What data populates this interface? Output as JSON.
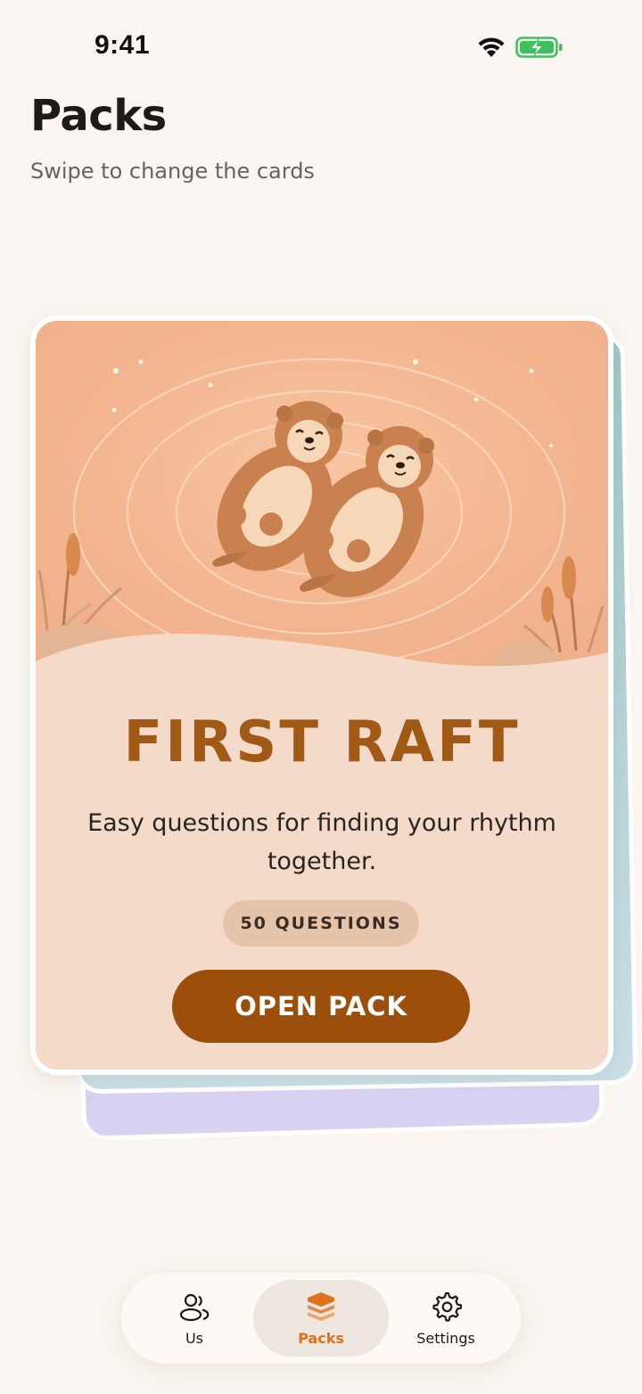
{
  "status_bar": {
    "time": "9:41",
    "wifi_icon": "wifi-icon",
    "battery_icon": "battery-charging-icon",
    "battery_color": "#3cc15e"
  },
  "header": {
    "title": "Packs",
    "subtitle": "Swipe to change the cards"
  },
  "pack_card": {
    "title": "FIRST RAFT",
    "description": "Easy questions for finding your rhythm together.",
    "badge": "50 QUESTIONS",
    "button_label": "OPEN PACK",
    "illustration": "two-otters-floating-illustration",
    "accent_color": "#a05a15",
    "button_color": "#9b4f0a"
  },
  "tab_bar": {
    "tabs": [
      {
        "label": "Us",
        "icon": "users-icon",
        "selected": false
      },
      {
        "label": "Packs",
        "icon": "stack-icon",
        "selected": true
      },
      {
        "label": "Settings",
        "icon": "gear-icon",
        "selected": false
      }
    ],
    "selected_color": "#e0701a"
  }
}
